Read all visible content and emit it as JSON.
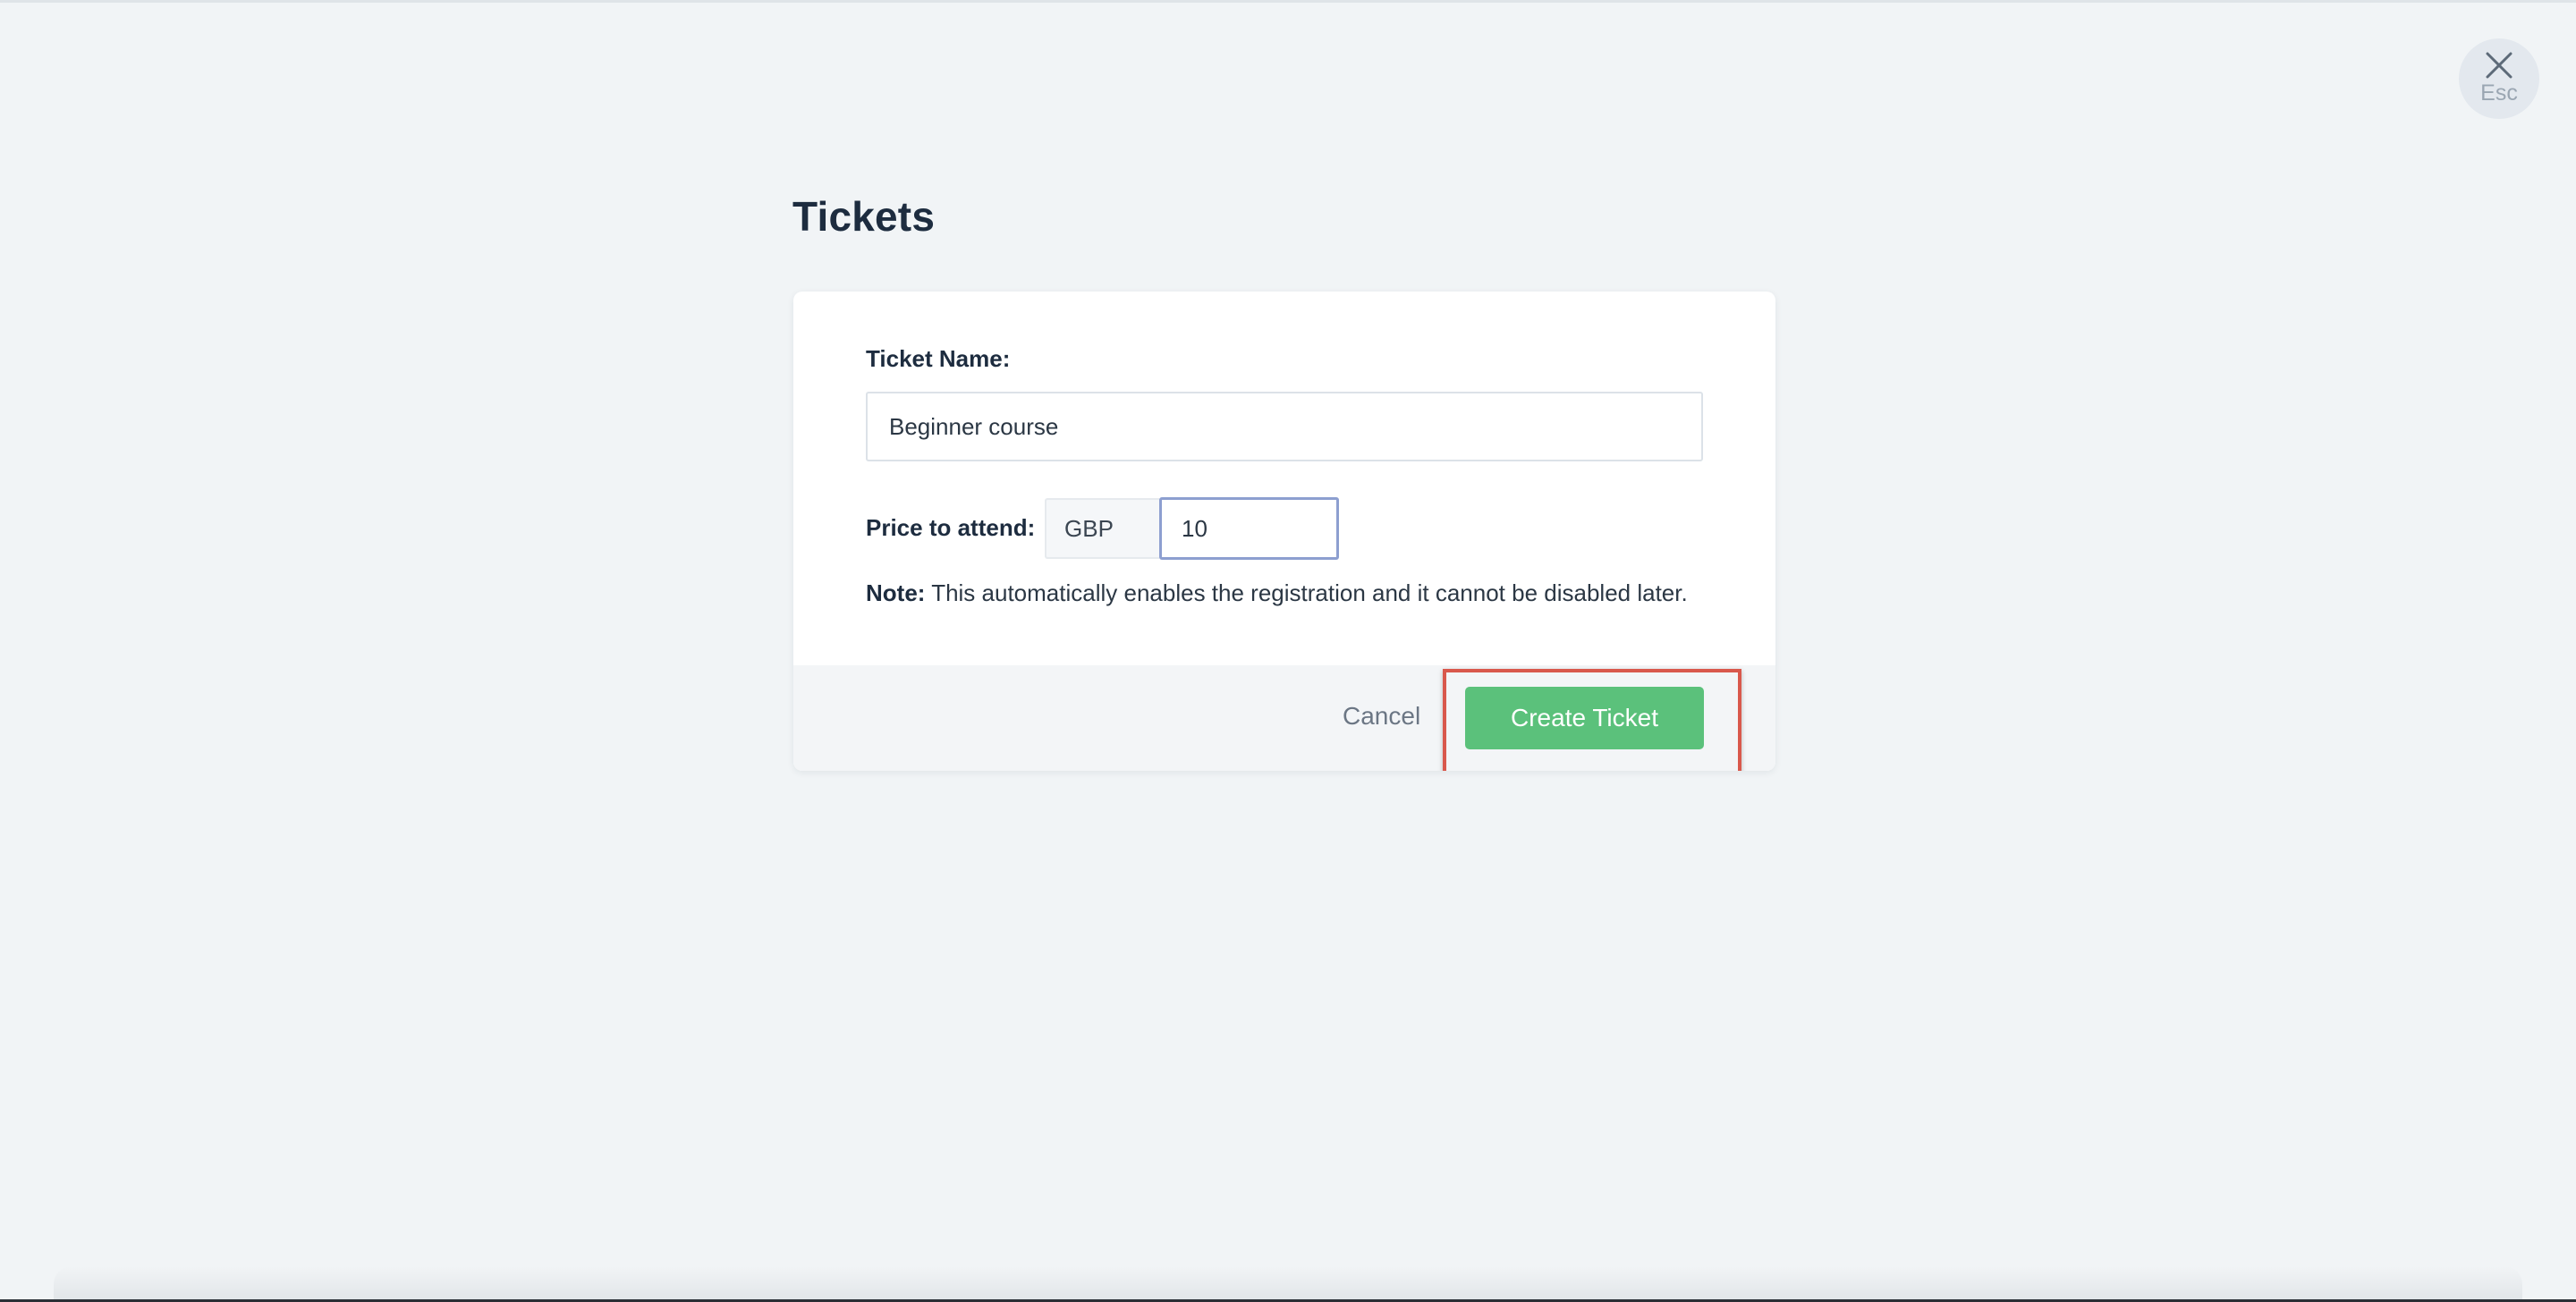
{
  "page": {
    "title": "Tickets"
  },
  "close": {
    "label": "Esc",
    "icon": "close-icon"
  },
  "form": {
    "ticket_name_label": "Ticket Name:",
    "ticket_name_value": "Beginner course",
    "price_label": "Price to attend:",
    "currency": "GBP",
    "price_value": "10",
    "note_prefix": "Note:",
    "note_text": " This automatically enables the registration and it cannot be disabled later."
  },
  "footer": {
    "cancel_label": "Cancel",
    "create_label": "Create Ticket"
  },
  "colors": {
    "primary_button": "#5bc17b",
    "highlight": "#d9584c",
    "focus_border": "#8d9fd0",
    "background": "#f1f4f6"
  }
}
